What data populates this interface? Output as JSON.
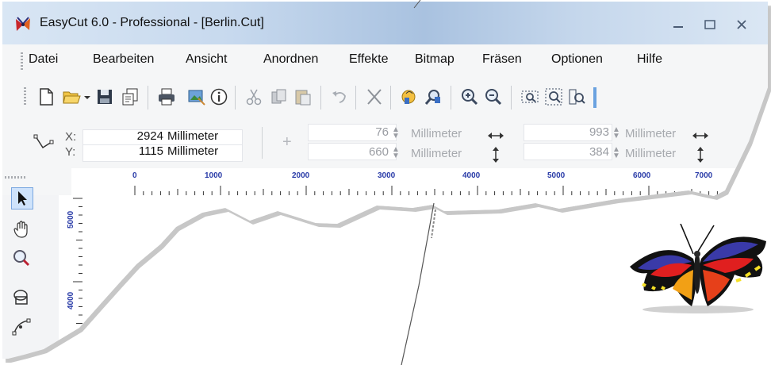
{
  "window": {
    "title": "EasyCut 6.0 - Professional - [Berlin.Cut]"
  },
  "menu": {
    "items": [
      "Datei",
      "Bearbeiten",
      "Ansicht",
      "Anordnen",
      "Effekte",
      "Bitmap",
      "Fräsen",
      "Optionen",
      "Hilfe"
    ]
  },
  "toolbar": {
    "icons": [
      "new-document-icon",
      "open-folder-icon",
      "save-icon",
      "save-as-icon",
      "print-icon",
      "import-icon",
      "info-icon",
      "cut-icon",
      "copy-icon",
      "paste-icon",
      "undo-icon",
      "delete-icon",
      "node-edit-icon",
      "find-icon",
      "zoom-in-icon",
      "zoom-out-icon",
      "zoom-selection-icon",
      "zoom-all-icon",
      "zoom-page-icon"
    ]
  },
  "properties": {
    "x_label": "X:",
    "y_label": "Y:",
    "x_value": "2924",
    "y_value": "1115",
    "unit": "Millimeter",
    "offset_x": "76",
    "offset_y": "660",
    "width": "993",
    "height": "384"
  },
  "ruler": {
    "labels": [
      "0",
      "1000",
      "2000",
      "3000",
      "4000",
      "5000",
      "6000",
      "7000"
    ],
    "vertical_labels": [
      "5000",
      "4000"
    ]
  },
  "colors": {
    "accent": "#2a3ca8",
    "titlebar": "#c7d9ee"
  }
}
